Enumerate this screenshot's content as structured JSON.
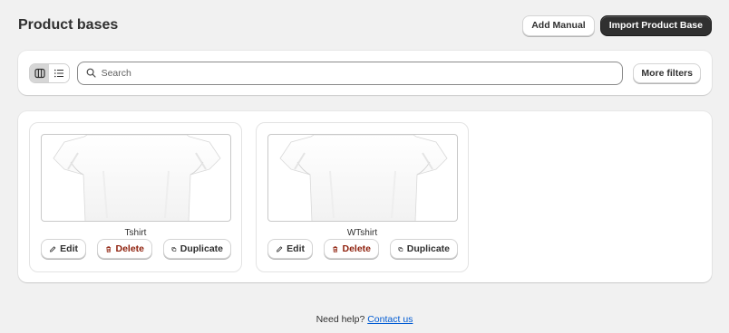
{
  "header": {
    "title": "Product bases",
    "add_manual_label": "Add Manual",
    "import_label": "Import Product Base"
  },
  "filters": {
    "view_modes": [
      "grid",
      "list"
    ],
    "active_view": "grid",
    "search_placeholder": "Search",
    "search_value": "",
    "more_filters_label": "More filters"
  },
  "products": [
    {
      "name": "Tshirt",
      "image_icon": "tshirt-image",
      "edit_label": "Edit",
      "delete_label": "Delete",
      "duplicate_label": "Duplicate"
    },
    {
      "name": "WTshirt",
      "image_icon": "tshirt-image",
      "edit_label": "Edit",
      "delete_label": "Delete",
      "duplicate_label": "Duplicate"
    }
  ],
  "footer": {
    "help_text": "Need help?",
    "contact_label": "Contact us"
  },
  "colors": {
    "primary_button": "#303030",
    "delete_text": "#8e1f0b",
    "link": "#005bd3",
    "background": "#f1f1f1"
  }
}
